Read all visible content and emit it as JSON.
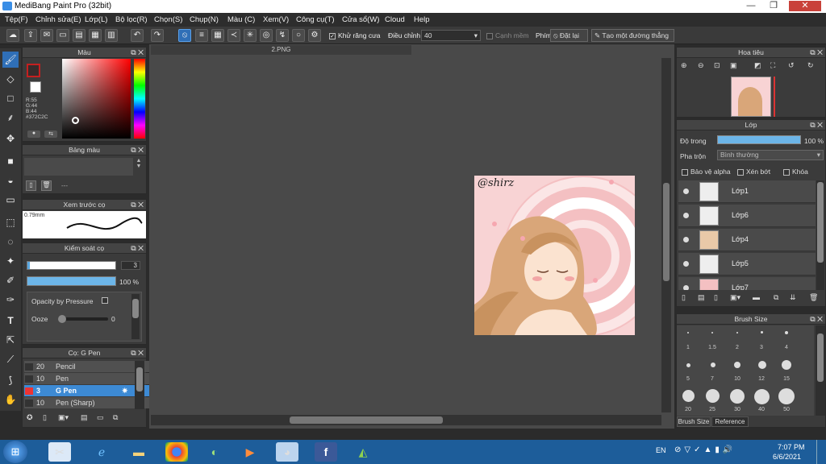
{
  "window": {
    "title": "MediBang Paint Pro (32bit)",
    "minimize": "—",
    "restore": "❐",
    "close": "✕"
  },
  "menu": [
    "Tệp(F)",
    "Chỉnh sửa(E)",
    "Lớp(L)",
    "Bộ lọc(R)",
    "Chọn(S)",
    "Chụp(N)",
    "Màu (C)",
    "Xem(V)",
    "Công cụ(T)",
    "Cửa sổ(W)",
    "Cloud",
    "Help"
  ],
  "toolbar": {
    "antialias_label": "Khử răng cưa",
    "correction_label": "Điều chỉnh",
    "correction_value": "40",
    "clip_label": "Cạnh mềm",
    "key_label": "Phím",
    "reset_label": "Đặt lại",
    "straight_line_label": "Tạo một đường thẳng"
  },
  "color_panel": {
    "title": "Màu",
    "r": "R:55",
    "g": "G:44",
    "b": "B:44",
    "hex": "#372C2C",
    "fg_color": "#372c2c"
  },
  "palette_panel": {
    "title": "Bảng màu",
    "value": "---"
  },
  "brush_preview_panel": {
    "title": "Xem trước cọ",
    "size": "0.79mm"
  },
  "brush_control_panel": {
    "title": "Kiểm soát cọ",
    "size_value": "3",
    "opacity_value": "100 %",
    "pressure_label": "Opacity by Pressure",
    "ooze_label": "Ooze",
    "ooze_value": "0"
  },
  "brush_list": {
    "title": "Cọ: G Pen",
    "items": [
      {
        "size": "20",
        "name": "Pencil"
      },
      {
        "size": "10",
        "name": "Pen"
      },
      {
        "size": "3",
        "name": "G Pen"
      },
      {
        "size": "10",
        "name": "Pen (Sharp)"
      }
    ]
  },
  "document": {
    "tab": "2.PNG",
    "signature": "@shirz"
  },
  "navigator": {
    "title": "Hoa tiêu"
  },
  "layer_panel": {
    "title": "Lớp",
    "opacity_label": "Độ trong",
    "opacity_value": "100 %",
    "blend_label": "Pha trộn",
    "blend_value": "Bình thường",
    "protect_alpha": "Bảo vệ alpha",
    "clipping": "Xén bớt",
    "lock": "Khóa",
    "layers": [
      "Lớp1",
      "Lớp6",
      "Lớp4",
      "Lớp5",
      "Lớp7"
    ]
  },
  "brush_size_panel": {
    "title": "Brush Size",
    "sizes": [
      "1",
      "1.5",
      "2",
      "3",
      "4",
      "5",
      "7",
      "10",
      "12",
      "15",
      "20",
      "25",
      "30",
      "40",
      "50"
    ],
    "tabs": [
      "Brush Size",
      "Reference"
    ]
  },
  "taskbar": {
    "lang": "EN",
    "time": "7:07 PM",
    "date": "6/6/2021"
  }
}
